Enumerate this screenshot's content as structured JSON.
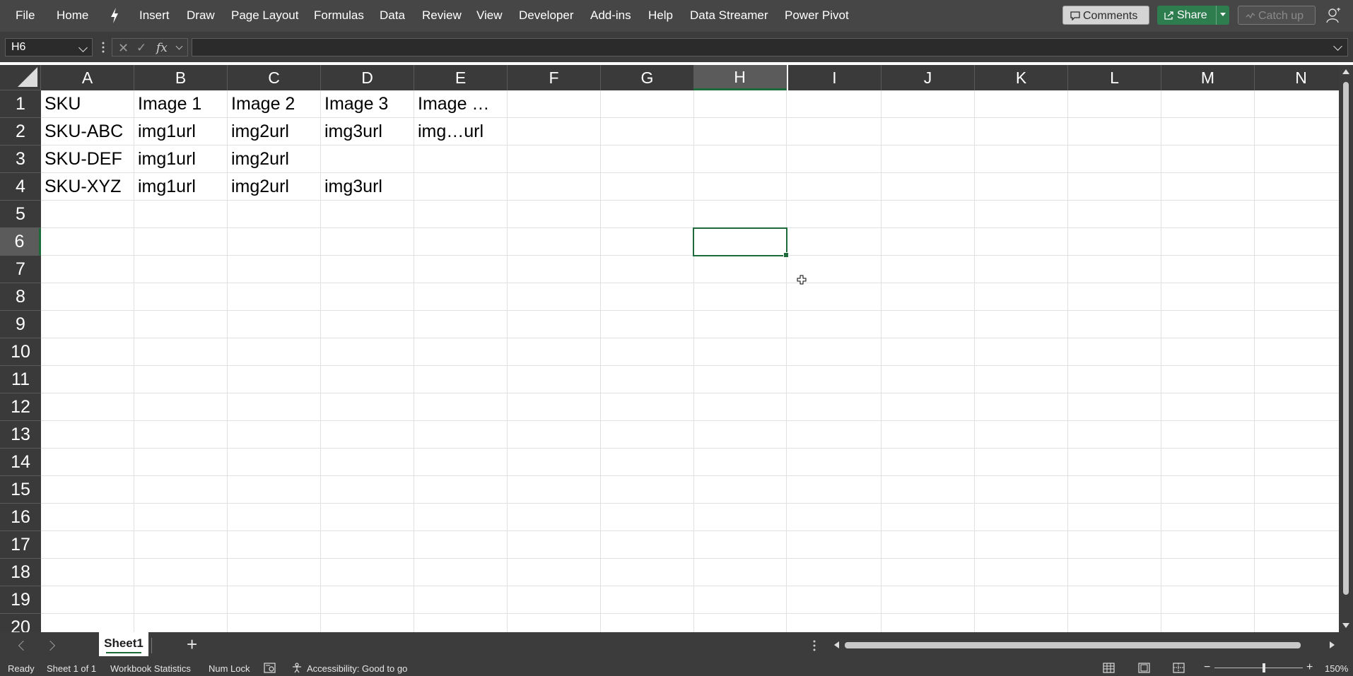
{
  "ribbon": {
    "tabs": [
      "File",
      "Home",
      "Insert",
      "Draw",
      "Page Layout",
      "Formulas",
      "Data",
      "Review",
      "View",
      "Developer",
      "Add-ins",
      "Help",
      "Data Streamer",
      "Power Pivot"
    ],
    "comments_label": "Comments",
    "share_label": "Share",
    "catchup_label": "Catch up"
  },
  "formula_bar": {
    "name_box": "H6",
    "fx_label": "fx",
    "formula": ""
  },
  "columns": [
    "A",
    "B",
    "C",
    "D",
    "E",
    "F",
    "G",
    "H",
    "I",
    "J",
    "K",
    "L",
    "M",
    "N"
  ],
  "rows": [
    "1",
    "2",
    "3",
    "4",
    "5",
    "6",
    "7",
    "8",
    "9",
    "10",
    "11",
    "12",
    "13",
    "14",
    "15",
    "16",
    "17",
    "18",
    "19",
    "20"
  ],
  "cells": {
    "A1": "SKU",
    "B1": "Image 1",
    "C1": "Image 2",
    "D1": "Image 3",
    "E1": "Image …",
    "A2": "SKU-ABC",
    "B2": "img1url",
    "C2": "img2url",
    "D2": "img3url",
    "E2": "img…url",
    "A3": "SKU-DEF",
    "B3": "img1url",
    "C3": "img2url",
    "A4": "SKU-XYZ",
    "B4": "img1url",
    "C4": "img2url",
    "D4": "img3url"
  },
  "active_cell": "H6",
  "sheet_tabs": [
    "Sheet1"
  ],
  "status": {
    "ready": "Ready",
    "sheet_count": "Sheet 1 of 1",
    "workbook_stats": "Workbook Statistics",
    "num_lock": "Num Lock",
    "accessibility": "Accessibility: Good to go",
    "zoom": "150%"
  },
  "colors": {
    "ribbon_bg": "#464646",
    "accent_green": "#1d6a3a",
    "share_green": "#2e7d4f",
    "header_bg": "#3a3a3a"
  },
  "icons": [
    "lightning-icon",
    "comment-icon",
    "share-icon",
    "catch-up-icon",
    "coach-icon",
    "cancel-icon",
    "check-icon",
    "fx-icon",
    "select-all-icon",
    "plus-cursor-icon",
    "add-sheet-icon",
    "macro-record-icon",
    "accessibility-icon",
    "normal-view-icon",
    "page-layout-view-icon",
    "page-break-view-icon",
    "zoom-out-icon",
    "zoom-in-icon"
  ]
}
